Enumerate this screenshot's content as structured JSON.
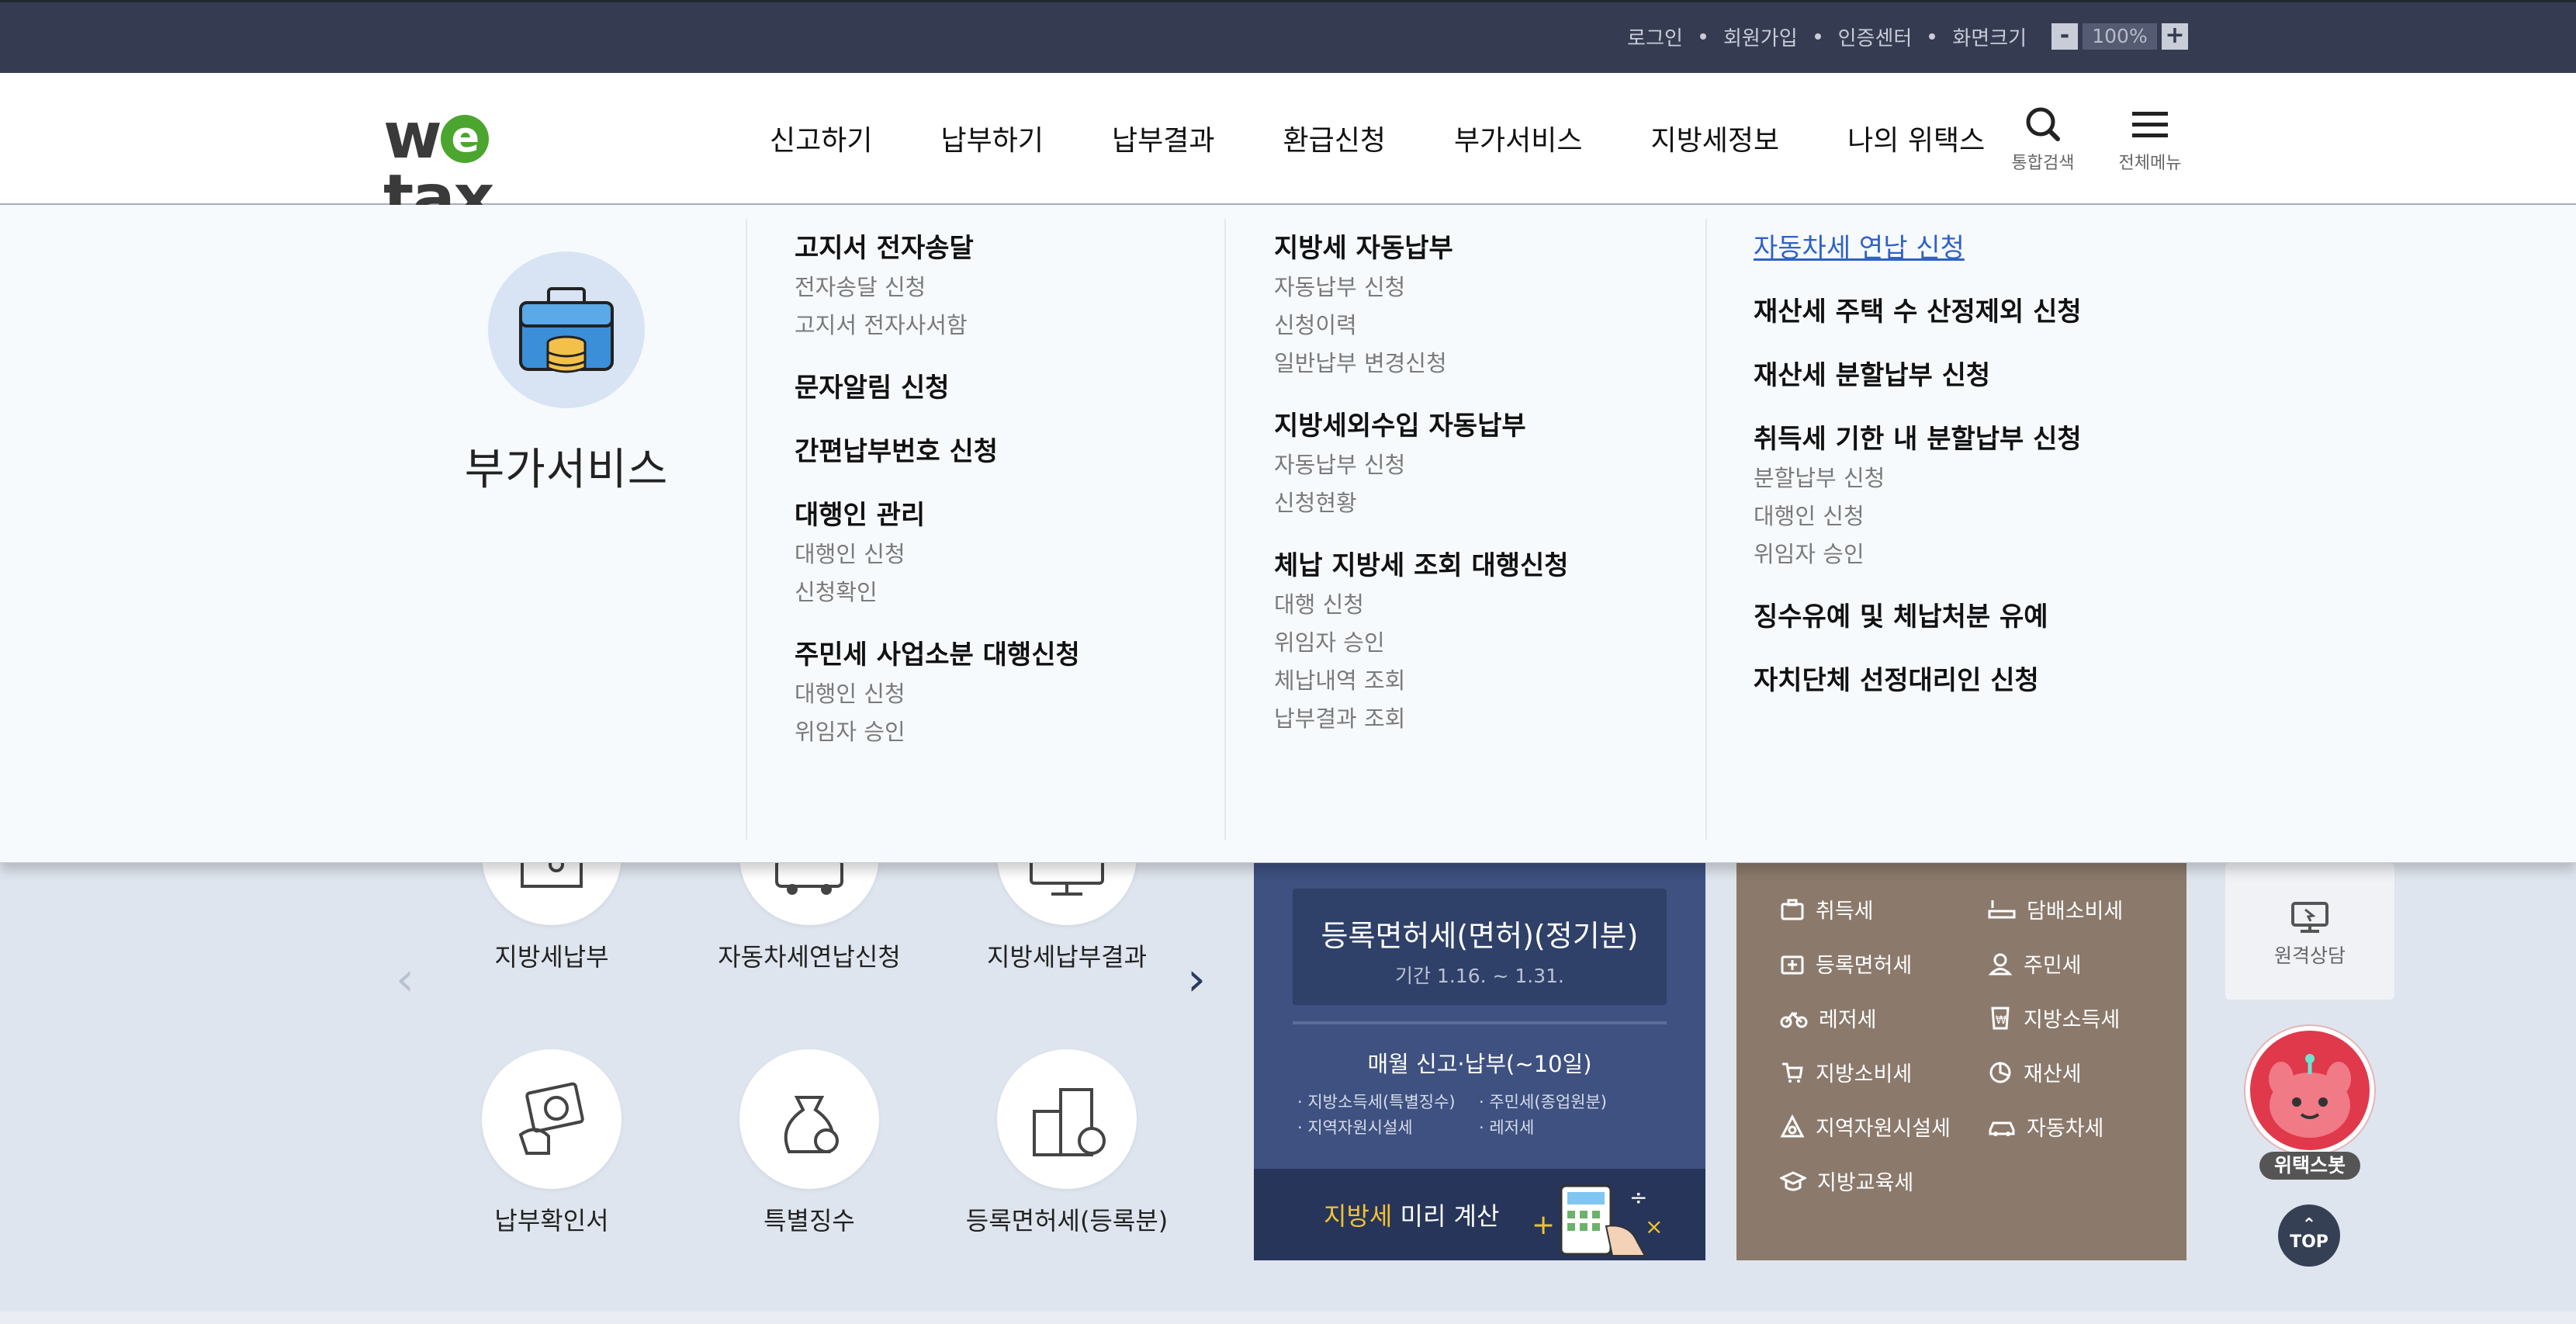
{
  "utility": {
    "links": [
      "로그인",
      "회원가입",
      "인증센터",
      "화면크기"
    ],
    "zoom_minus": "-",
    "zoom_value": "100%",
    "zoom_plus": "+"
  },
  "header": {
    "logo": "wetax",
    "nav": [
      "신고하기",
      "납부하기",
      "납부결과",
      "환급신청",
      "부가서비스",
      "지방세정보",
      "나의 위택스"
    ],
    "search_label": "통합검색",
    "menu_label": "전체메뉴"
  },
  "mega": {
    "title": "부가서비스",
    "col1": [
      {
        "head": "고지서 전자송달",
        "subs": [
          "전자송달 신청",
          "고지서 전자사서함"
        ]
      },
      {
        "head": "문자알림 신청",
        "subs": []
      },
      {
        "head": "간편납부번호 신청",
        "subs": []
      },
      {
        "head": "대행인 관리",
        "subs": [
          "대행인 신청",
          "신청확인"
        ]
      },
      {
        "head": "주민세 사업소분 대행신청",
        "subs": [
          "대행인 신청",
          "위임자 승인"
        ]
      }
    ],
    "col2": [
      {
        "head": "지방세 자동납부",
        "subs": [
          "자동납부 신청",
          "신청이력",
          "일반납부 변경신청"
        ]
      },
      {
        "head": "지방세외수입 자동납부",
        "subs": [
          "자동납부 신청",
          "신청현황"
        ]
      },
      {
        "head": "체납 지방세 조회 대행신청",
        "subs": [
          "대행 신청",
          "위임자 승인",
          "체납내역 조회",
          "납부결과 조회"
        ]
      }
    ],
    "col3": [
      {
        "head": "자동차세 연납 신청",
        "subs": []
      },
      {
        "head": "재산세 주택 수 산정제외 신청",
        "subs": []
      },
      {
        "head": "재산세 분할납부 신청",
        "subs": []
      },
      {
        "head": "취득세 기한 내 분할납부 신청",
        "subs": [
          "분할납부 신청",
          "대행인 신청",
          "위임자 승인"
        ]
      },
      {
        "head": "징수유예 및 체납처분 유예",
        "subs": []
      },
      {
        "head": "자치단체 선정대리인 신청",
        "subs": []
      }
    ]
  },
  "quick": [
    "지방세납부",
    "자동차세연납신청",
    "지방세납부결과",
    "납부확인서",
    "특별징수",
    "등록면허세(등록분)"
  ],
  "notice": {
    "title": "등록면허세(면허)(정기분)",
    "period": "기간 1.16. ~ 1.31.",
    "monthly": "매월 신고·납부(~10일)",
    "list_left": [
      "지방소득세(특별징수)",
      "지역자원시설세"
    ],
    "list_right": [
      "주민세(종업원분)",
      "레저세"
    ],
    "calc_highlight": "지방세",
    "calc_rest": " 미리 계산"
  },
  "taxes": [
    "취득세",
    "담배소비세",
    "등록면허세",
    "주민세",
    "레저세",
    "지방소득세",
    "지방소비세",
    "재산세",
    "지역자원시설세",
    "자동차세",
    "지방교육세"
  ],
  "side": {
    "remote": "원격상담",
    "bot": "위택스봇",
    "top": "TOP"
  },
  "colors": {
    "topbar": "#353c52",
    "notice": "#3e5180",
    "taxbox": "#8b7a6c",
    "link_blue": "#2f62c8",
    "logo_green": "#4ba52f"
  }
}
